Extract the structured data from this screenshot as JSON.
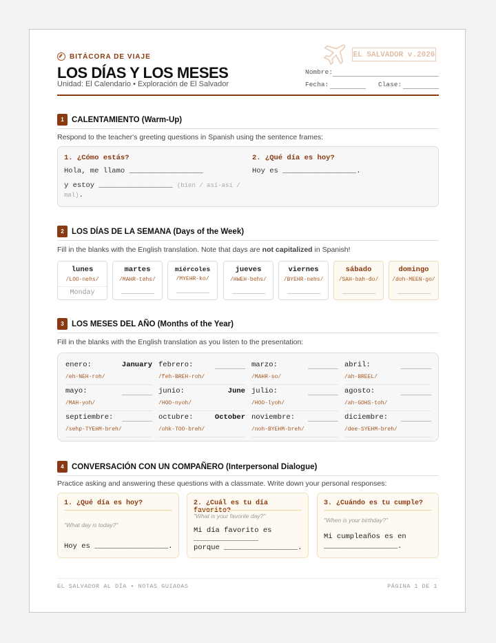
{
  "header": {
    "brand": "BITÁCORA DE VIAJE",
    "title": "LOS DÍAS Y LOS MESES",
    "subtitle": "Unidad: El Calendario • Exploración de El Salvador",
    "stamp": "EL SALVADOR v.2026",
    "name_label": "Nombre:",
    "date_label": "Fecha:",
    "class_label": "Clase:"
  },
  "warmup": {
    "num": "1",
    "title": "CALENTAMIENTO (Warm-Up)",
    "instructions": "Respond to the teacher's greeting questions in Spanish using the sentence frames:",
    "q1": "1. ¿Cómo estás?",
    "q1_line1": "Hola, me llamo _________________",
    "q1_line2": "y estoy _________________",
    "q1_hint": "(bien / así-así /",
    "q1_hint2": "mal)",
    "q1_end": ".",
    "q2": "2. ¿Qué día es hoy?",
    "q2_line": "Hoy es _________________."
  },
  "days": {
    "num": "2",
    "title": "LOS DÍAS DE LA SEMANA (Days of the Week)",
    "instr_pre": "Fill in the blanks with the English translation. Note that days are ",
    "instr_bold": "not capitalized",
    "instr_post": " in Spanish!",
    "items": [
      {
        "name": "lunes",
        "pron": "/LOO-nehs/",
        "answer": "Monday"
      },
      {
        "name": "martes",
        "pron": "/MAHR-tehs/",
        "answer": ""
      },
      {
        "name": "miércoles",
        "pron": "/MYEHR-ko/",
        "answer": ""
      },
      {
        "name": "jueves",
        "pron": "/HWEH-behs/",
        "answer": ""
      },
      {
        "name": "viernes",
        "pron": "/BYEHR-nehs/",
        "answer": ""
      },
      {
        "name": "sábado",
        "pron": "/SAH-bah-do/",
        "answer": ""
      },
      {
        "name": "domingo",
        "pron": "/doh-MEEN-go/",
        "answer": ""
      }
    ]
  },
  "months": {
    "num": "3",
    "title": "LOS MESES DEL AÑO (Months of the Year)",
    "instructions": "Fill in the blanks with the English translation as you listen to the presentation:",
    "items": [
      {
        "name": "enero:",
        "pron": "/eh-NEH-roh/",
        "answer": "January"
      },
      {
        "name": "febrero:",
        "pron": "/feh-BREH-roh/",
        "answer": ""
      },
      {
        "name": "marzo:",
        "pron": "/MAHR-so/",
        "answer": ""
      },
      {
        "name": "abril:",
        "pron": "/ah-BREEL/",
        "answer": ""
      },
      {
        "name": "mayo:",
        "pron": "/MAH-yoh/",
        "answer": ""
      },
      {
        "name": "junio:",
        "pron": "/HOO-nyoh/",
        "answer": "June"
      },
      {
        "name": "julio:",
        "pron": "/HOO-lyoh/",
        "answer": ""
      },
      {
        "name": "agosto:",
        "pron": "/ah-GOHS-toh/",
        "answer": ""
      },
      {
        "name": "septiembre:",
        "pron": "/sehp-TYEHM-breh/",
        "answer": ""
      },
      {
        "name": "octubre:",
        "pron": "/ohk-TOO-breh/",
        "answer": "October"
      },
      {
        "name": "noviembre:",
        "pron": "/noh-BYEHM-breh/",
        "answer": ""
      },
      {
        "name": "diciembre:",
        "pron": "/dee-SYEHM-breh/",
        "answer": ""
      }
    ]
  },
  "dialogue": {
    "num": "4",
    "title": "CONVERSACIÓN CON UN COMPAÑERO (Interpersonal Dialogue)",
    "instructions": "Practice asking and answering these questions with a classmate. Write down your personal responses:",
    "cards": [
      {
        "q": "1. ¿Qué día es hoy?",
        "en": "\"What day is today?\"",
        "a1": "Hoy es _________________.",
        "a2": ""
      },
      {
        "q": "2. ¿Cuál es tu día favorito?",
        "en": "\"What is your favorite day?\"",
        "a1": "Mi día favorito es",
        "a2": "porque _________________."
      },
      {
        "q": "3. ¿Cuándo es tu cumple?",
        "en": "\"When is your birthday?\"",
        "a1": "Mi cumpleaños es en",
        "a2": "_________________."
      }
    ]
  },
  "footer": {
    "left": "EL SALVADOR AL DÍA • NOTAS GUIADAS",
    "right": "PÁGINA 1 DE 1"
  },
  "colors": {
    "accent": "#8a3a12",
    "stamp": "#e0bfa8",
    "weekend_bg": "#fffaf1"
  }
}
